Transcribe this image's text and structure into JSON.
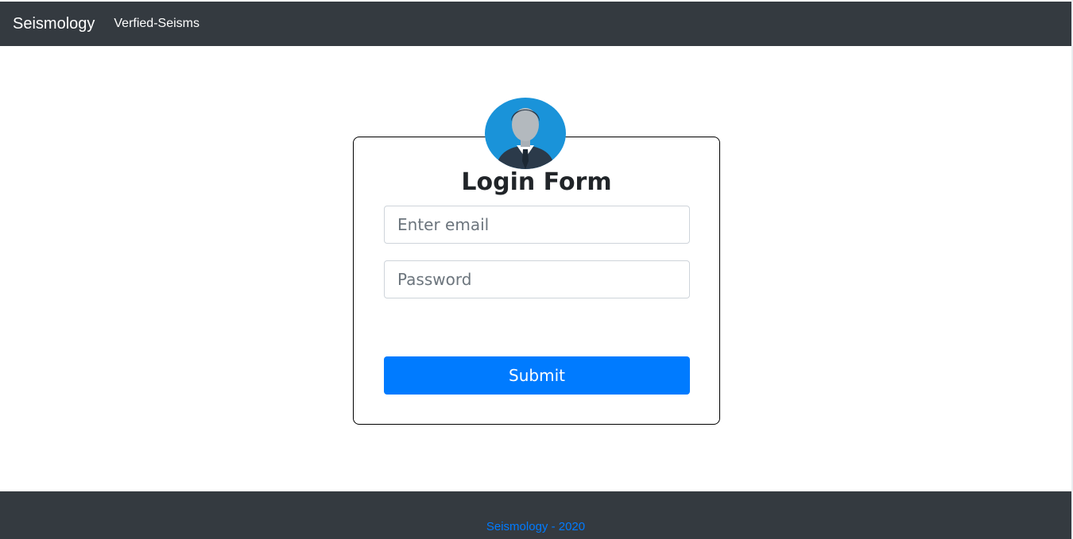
{
  "navbar": {
    "brand": "Seismology",
    "links": [
      "Verfied-Seisms"
    ]
  },
  "login": {
    "avatar_icon": "user-avatar-icon",
    "title": "Login Form",
    "email_placeholder": "Enter email",
    "email_value": "",
    "password_placeholder": "Password",
    "password_value": "",
    "submit_label": "Submit"
  },
  "footer": {
    "text": "Seismology - 2020"
  },
  "colors": {
    "navbar_bg": "#343a40",
    "accent": "#007bff",
    "avatar_bg": "#1a93d9"
  }
}
